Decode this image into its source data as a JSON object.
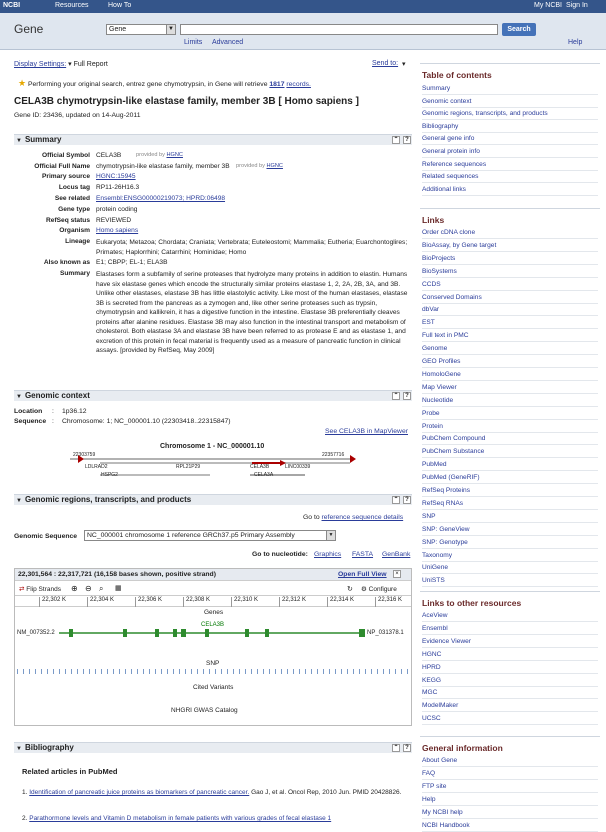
{
  "topbar": {
    "logo": "NCBI",
    "resources": "Resources",
    "howto": "How To",
    "myncbi": "My NCBI",
    "signin": "Sign In"
  },
  "search": {
    "db_label": "Gene",
    "db_select": "Gene",
    "button": "Search",
    "limits": "Limits",
    "advanced": "Advanced",
    "help": "Help"
  },
  "display": {
    "settings": "Display Settings:",
    "mode": "Full Report",
    "sendto": "Send to:"
  },
  "notice": {
    "text": "Performing your original search, entrez gene chymotrypsin, in Gene will retrieve",
    "count": "1817",
    "suffix": "records."
  },
  "gene": {
    "title": "CELA3B chymotrypsin-like elastase family, member 3B [ Homo sapiens ]",
    "id": "Gene ID: 23436, updated on 14-Aug-2011"
  },
  "summary": {
    "header": "Summary",
    "rows": [
      {
        "k": "Official Symbol",
        "v": "CELA3B",
        "prov": "provided by",
        "src": "HGNC"
      },
      {
        "k": "Official Full Name",
        "v": "chymotrypsin-like elastase family, member 3B",
        "prov": "provided by",
        "src": "HGNC"
      },
      {
        "k": "Primary source",
        "v": "HGNC:15945"
      },
      {
        "k": "Locus tag",
        "v": "RP11-26H16.3"
      },
      {
        "k": "See related",
        "v": "Ensembl:ENSG00000219073; HPRD:06498"
      },
      {
        "k": "Gene type",
        "v": "protein coding"
      },
      {
        "k": "RefSeq status",
        "v": "REVIEWED"
      },
      {
        "k": "Organism",
        "v": "Homo sapiens"
      },
      {
        "k": "Lineage",
        "v": "Eukaryota; Metazoa; Chordata; Craniata; Vertebrata; Euteleostomi; Mammalia; Eutheria; Euarchontoglires; Primates; Haplorrhini; Catarrhini; Hominidae; Homo"
      },
      {
        "k": "Also known as",
        "v": "E1; CBPP; EL-1; ELA3B"
      }
    ],
    "summary_label": "Summary",
    "summary_text": "Elastases form a subfamily of serine proteases that hydrolyze many proteins in addition to elastin. Humans have six elastase genes which encode the structurally similar proteins elastase 1, 2, 2A, 2B, 3A, and 3B. Unlike other elastases, elastase 3B has little elastolytic activity. Like most of the human elastases, elastase 3B is secreted from the pancreas as a zymogen and, like other serine proteases such as trypsin, chymotrypsin and kallikrein, it has a digestive function in the intestine. Elastase 3B preferentially cleaves proteins after alanine residues. Elastase 3B may also function in the intestinal transport and metabolism of cholesterol. Both elastase 3A and elastase 3B have been referred to as protease E and as elastase 1, and excretion of this protein in fecal material is frequently used as a measure of pancreatic function in clinical assays. [provided by RefSeq, May 2009]"
  },
  "genomic": {
    "header": "Genomic context",
    "location_k": "Location",
    "location_v": "1p36.12",
    "sequence_k": "Sequence",
    "sequence_v": "Chromosome: 1; NC_000001.10 (22303418..22315847)",
    "mapviewer": "See CELA3B in MapViewer",
    "chrom_title": "Chromosome 1 - NC_000001.10",
    "left_coord": "22303759",
    "right_coord": "22357716",
    "genes_top": [
      "LDLRAD2",
      "RPL21P29",
      "CELA3B",
      "LINC00339"
    ],
    "genes_bottom": [
      "HSPG2",
      "CELA3A"
    ]
  },
  "regions": {
    "header": "Genomic regions, transcripts, and products",
    "goto": "Go to",
    "goto_link": "reference sequence details",
    "seq_label": "Genomic Sequence",
    "seq_select": "NC_000001 chromosome 1 reference GRCh37.p5 Primary Assembly",
    "goto_nuc": "Go to nucleotide:",
    "graphics": "Graphics",
    "fasta": "FASTA",
    "genbank": "GenBank"
  },
  "viewer": {
    "range": "22,301,564 : 22,317,721 (16,158 bases shown, positive strand)",
    "open_full": "Open Full View",
    "flip": "Flip Strands",
    "configure": "Configure",
    "ticks": [
      "22,302 K",
      "22,304 K",
      "22,306 K",
      "22,308 K",
      "22,310 K",
      "22,312 K",
      "22,314 K",
      "22,316 K"
    ],
    "tracks": {
      "genes": "Genes",
      "gene_label": "CELA3B",
      "left_tx": "NM_007352.2",
      "right_tx": "NP_031378.1",
      "snp": "SNP",
      "cited": "Cited Variants",
      "gwas": "NHGRI GWAS Catalog"
    }
  },
  "bibliography": {
    "header": "Bibliography",
    "related": "Related articles in PubMed",
    "items": [
      {
        "n": "1.",
        "title": "Identification of pancreatic juice proteins as biomarkers of pancreatic cancer.",
        "rest": "Gao J, et al. Oncol Rep, 2010 Jun. PMID 20428826."
      },
      {
        "n": "2.",
        "title": "Parathormone levels and Vitamin D metabolism in female patients with various grades of fecal elastase 1",
        "rest": ""
      }
    ]
  },
  "toc": {
    "title": "Table of contents",
    "items": [
      "Summary",
      "Genomic context",
      "Genomic regions, transcripts, and products",
      "Bibliography",
      "General gene info",
      "General protein info",
      "Reference sequences",
      "Related sequences",
      "Additional links"
    ]
  },
  "links": {
    "title": "Links",
    "items": [
      "Order cDNA clone",
      "BioAssay, by Gene target",
      "BioProjects",
      "BioSystems",
      "CCDS",
      "Conserved Domains",
      "dbVar",
      "EST",
      "Full text in PMC",
      "Genome",
      "GEO Profiles",
      "HomoloGene",
      "Map Viewer",
      "Nucleotide",
      "Probe",
      "Protein",
      "PubChem Compound",
      "PubChem Substance",
      "PubMed",
      "PubMed (GeneRIF)",
      "RefSeq Proteins",
      "RefSeq RNAs",
      "SNP",
      "SNP: GeneView",
      "SNP: Genotype",
      "Taxonomy",
      "UniGene",
      "UniSTS"
    ]
  },
  "other_links": {
    "title": "Links to other resources",
    "items": [
      "AceView",
      "Ensembl",
      "Evidence Viewer",
      "HGNC",
      "HPRD",
      "KEGG",
      "MGC",
      "ModelMaker",
      "UCSC"
    ]
  },
  "general": {
    "title": "General information",
    "items": [
      "About Gene",
      "FAQ",
      "FTP site",
      "Help",
      "My NCBI help",
      "NCBI Handbook"
    ]
  }
}
